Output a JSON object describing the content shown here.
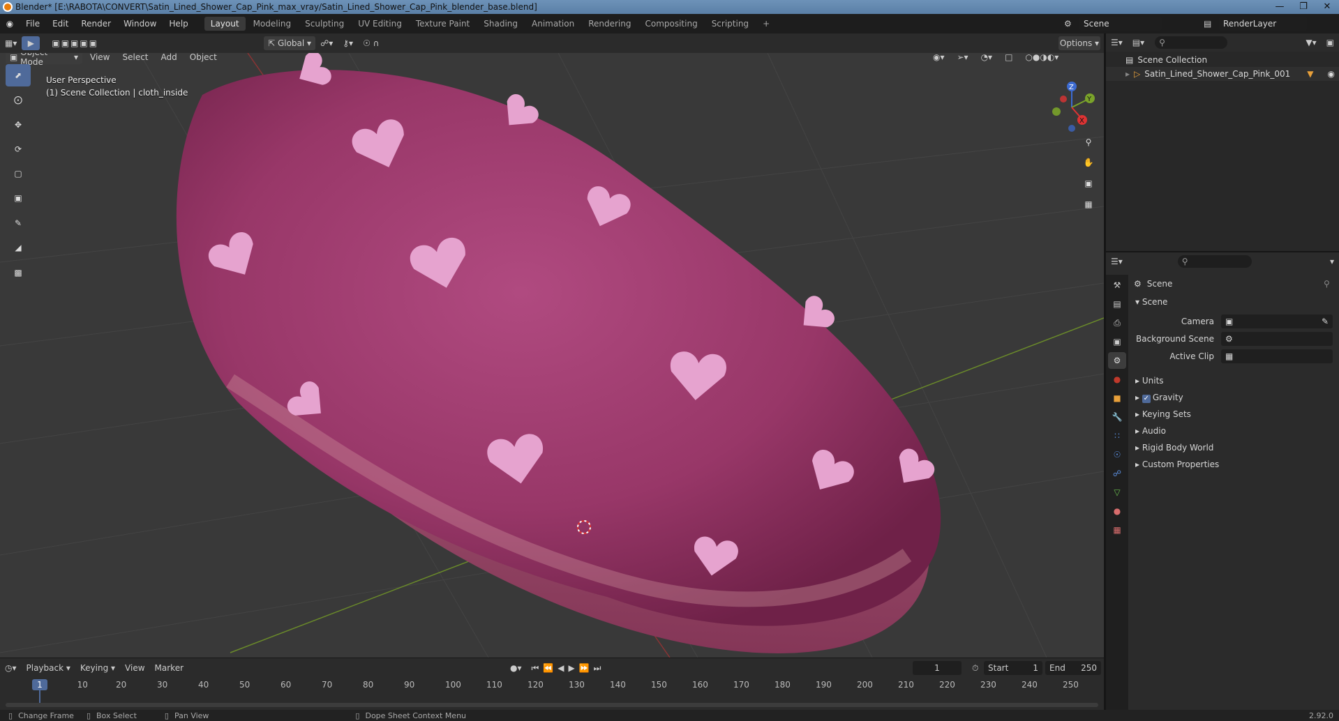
{
  "window": {
    "title": "Blender* [E:\\RABOTA\\CONVERT\\Satin_Lined_Shower_Cap_Pink_max_vray/Satin_Lined_Shower_Cap_Pink_blender_base.blend]"
  },
  "menu": {
    "file": "File",
    "edit": "Edit",
    "render": "Render",
    "window": "Window",
    "help": "Help"
  },
  "workspaces": [
    "Layout",
    "Modeling",
    "Sculpting",
    "UV Editing",
    "Texture Paint",
    "Shading",
    "Animation",
    "Rendering",
    "Compositing",
    "Scripting"
  ],
  "topright": {
    "scene": "Scene",
    "view_layer": "RenderLayer"
  },
  "viewport_header": {
    "mode": "Object Mode",
    "view": "View",
    "select": "Select",
    "add": "Add",
    "object": "Object",
    "orientation": "Global",
    "options": "Options"
  },
  "viewport_info": {
    "perspective": "User Perspective",
    "collection": "(1) Scene Collection | cloth_inside"
  },
  "gizmo": {
    "x": "X",
    "y": "Y",
    "z": "Z"
  },
  "outliner": {
    "root": "Scene Collection",
    "item": "Satin_Lined_Shower_Cap_Pink_001"
  },
  "properties": {
    "context": "Scene",
    "panel": "Scene",
    "camera_label": "Camera",
    "bg_scene_label": "Background Scene",
    "active_clip_label": "Active Clip",
    "sections": [
      "Units",
      "Gravity",
      "Keying Sets",
      "Audio",
      "Rigid Body World",
      "Custom Properties"
    ]
  },
  "timeline": {
    "playback": "Playback",
    "keying": "Keying",
    "view": "View",
    "marker": "Marker",
    "current_frame": "1",
    "start_label": "Start",
    "start": "1",
    "end_label": "End",
    "end": "250",
    "ruler_current": "1",
    "ruler": [
      "10",
      "20",
      "30",
      "40",
      "50",
      "60",
      "70",
      "80",
      "90",
      "100",
      "110",
      "120",
      "130",
      "140",
      "150",
      "160",
      "170",
      "180",
      "190",
      "200",
      "210",
      "220",
      "230",
      "240",
      "250"
    ]
  },
  "status": {
    "change_frame": "Change Frame",
    "box_select": "Box Select",
    "pan_view": "Pan View",
    "context_menu": "Dope Sheet Context Menu",
    "version": "2.92.0"
  },
  "colors": {
    "accent": "#4f6a9a",
    "cap": "#a33d72",
    "heart": "#e6a3cf",
    "grid_x": "#8a3434",
    "grid_y": "#6a8a2a"
  }
}
